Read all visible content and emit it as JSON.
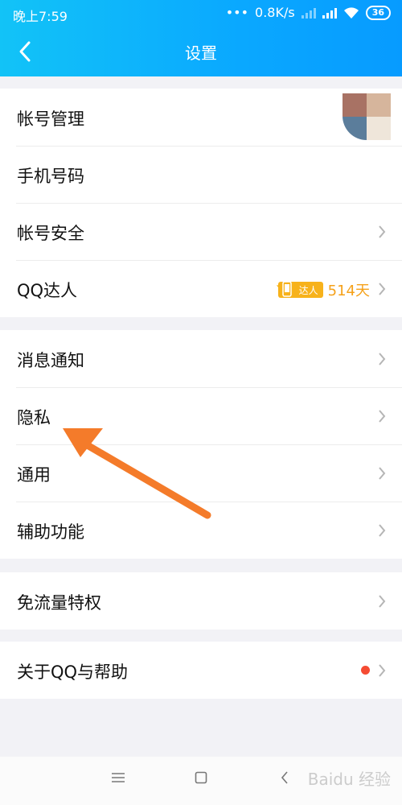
{
  "status_bar": {
    "time": "晚上7:59",
    "network_speed": "0.8K/s",
    "battery": "36"
  },
  "header": {
    "title": "设置"
  },
  "groups": [
    {
      "items": [
        {
          "label": "帐号管理"
        },
        {
          "label": "手机号码"
        },
        {
          "label": "帐号安全"
        },
        {
          "label": "QQ达人",
          "badge": "达人",
          "days": "514天"
        }
      ]
    },
    {
      "items": [
        {
          "label": "消息通知"
        },
        {
          "label": "隐私"
        },
        {
          "label": "通用"
        },
        {
          "label": "辅助功能"
        }
      ]
    },
    {
      "items": [
        {
          "label": "免流量特权"
        }
      ]
    },
    {
      "items": [
        {
          "label": "关于QQ与帮助"
        }
      ]
    }
  ],
  "colors": {
    "header_gradient_start": "#12c3f7",
    "header_gradient_end": "#079bff",
    "badge": "#f7b21b",
    "days_text": "#f5a11a",
    "red_dot": "#f54b33",
    "annotation_arrow": "#f47b2a"
  },
  "icons": {
    "back": "chevron-left-icon",
    "row_arrow": "chevron-right-icon",
    "nav_menu": "menu-icon",
    "nav_home": "square-icon",
    "nav_back": "triangle-back-icon"
  },
  "watermark": "Baidu 经验"
}
